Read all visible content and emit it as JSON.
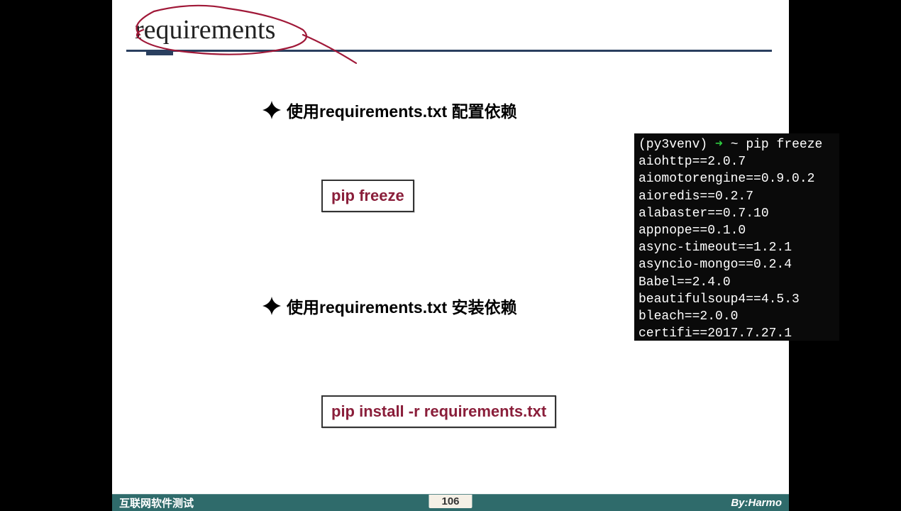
{
  "title": "requirements",
  "bullets": {
    "config": "使用requirements.txt 配置依赖",
    "install": "使用requirements.txt 安装依赖"
  },
  "commands": {
    "freeze": "pip freeze",
    "install": "pip install -r requirements.txt"
  },
  "terminal": {
    "venv": "(py3venv)",
    "arrow": "➜",
    "tilde": "~",
    "cmd": "pip freeze",
    "output": [
      "aiohttp==2.0.7",
      "aiomotorengine==0.9.0.2",
      "aioredis==0.2.7",
      "alabaster==0.7.10",
      "appnope==0.1.0",
      "async-timeout==1.2.1",
      "asyncio-mongo==0.2.4",
      "Babel==2.4.0",
      "beautifulsoup4==4.5.3",
      "bleach==2.0.0",
      "certifi==2017.7.27.1"
    ]
  },
  "footer": {
    "left": "互联网软件测试",
    "page": "106",
    "right": "By:Harmo"
  }
}
